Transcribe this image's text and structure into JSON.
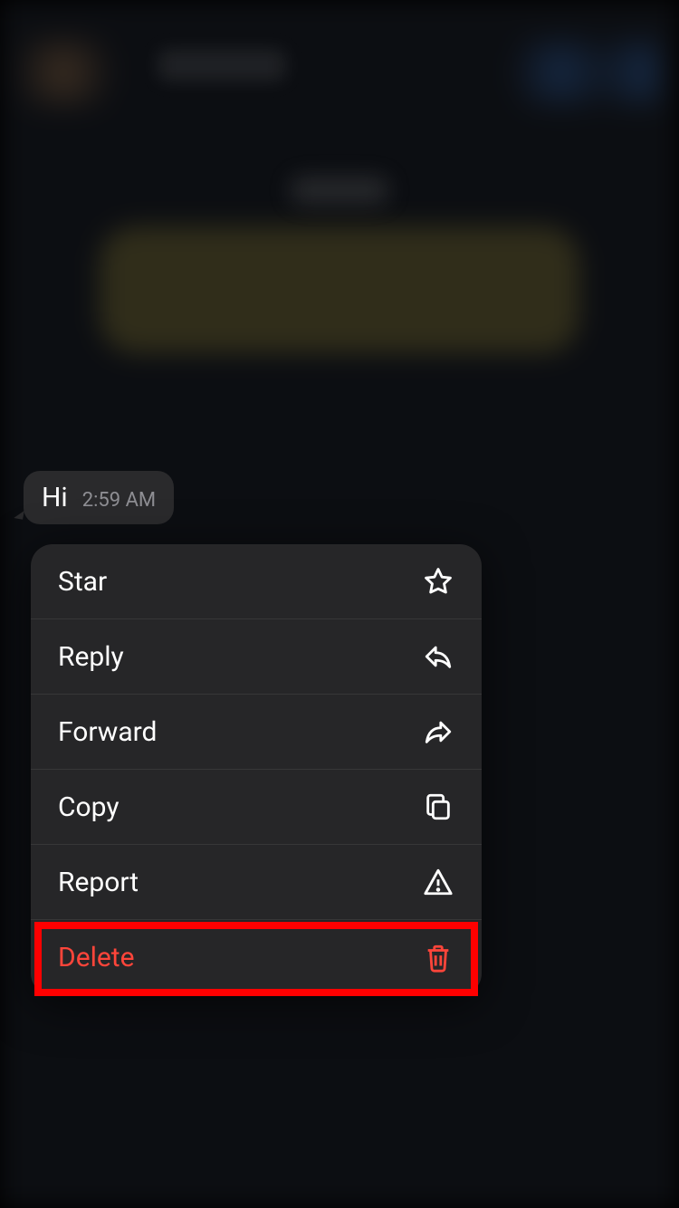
{
  "message": {
    "text": "Hi",
    "timestamp": "2:59 AM"
  },
  "menu": {
    "items": [
      {
        "label": "Star",
        "icon": "star-icon",
        "danger": false
      },
      {
        "label": "Reply",
        "icon": "reply-icon",
        "danger": false
      },
      {
        "label": "Forward",
        "icon": "forward-icon",
        "danger": false
      },
      {
        "label": "Copy",
        "icon": "copy-icon",
        "danger": false
      },
      {
        "label": "Report",
        "icon": "report-icon",
        "danger": false
      },
      {
        "label": "Delete",
        "icon": "trash-icon",
        "danger": true
      }
    ]
  },
  "highlight_index": 5
}
